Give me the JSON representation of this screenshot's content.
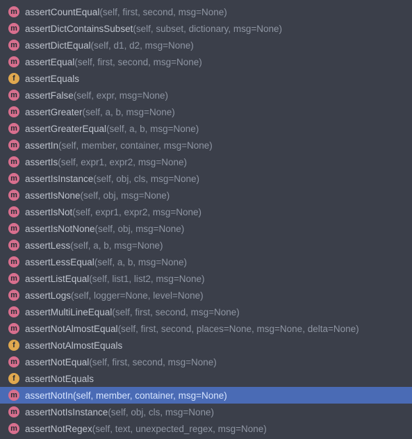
{
  "icon_glyph": {
    "m": "m",
    "f": "f"
  },
  "items": [
    {
      "kind": "m",
      "name": "assertCountEqual",
      "params": "(self, first, second, msg=None)",
      "selected": false
    },
    {
      "kind": "m",
      "name": "assertDictContainsSubset",
      "params": "(self, subset, dictionary, msg=None)",
      "selected": false
    },
    {
      "kind": "m",
      "name": "assertDictEqual",
      "params": "(self, d1, d2, msg=None)",
      "selected": false
    },
    {
      "kind": "m",
      "name": "assertEqual",
      "params": "(self, first, second, msg=None)",
      "selected": false
    },
    {
      "kind": "f",
      "name": "assertEquals",
      "params": "",
      "selected": false
    },
    {
      "kind": "m",
      "name": "assertFalse",
      "params": "(self, expr, msg=None)",
      "selected": false
    },
    {
      "kind": "m",
      "name": "assertGreater",
      "params": "(self, a, b, msg=None)",
      "selected": false
    },
    {
      "kind": "m",
      "name": "assertGreaterEqual",
      "params": "(self, a, b, msg=None)",
      "selected": false
    },
    {
      "kind": "m",
      "name": "assertIn",
      "params": "(self, member, container, msg=None)",
      "selected": false
    },
    {
      "kind": "m",
      "name": "assertIs",
      "params": "(self, expr1, expr2, msg=None)",
      "selected": false
    },
    {
      "kind": "m",
      "name": "assertIsInstance",
      "params": "(self, obj, cls, msg=None)",
      "selected": false
    },
    {
      "kind": "m",
      "name": "assertIsNone",
      "params": "(self, obj, msg=None)",
      "selected": false
    },
    {
      "kind": "m",
      "name": "assertIsNot",
      "params": "(self, expr1, expr2, msg=None)",
      "selected": false
    },
    {
      "kind": "m",
      "name": "assertIsNotNone",
      "params": "(self, obj, msg=None)",
      "selected": false
    },
    {
      "kind": "m",
      "name": "assertLess",
      "params": "(self, a, b, msg=None)",
      "selected": false
    },
    {
      "kind": "m",
      "name": "assertLessEqual",
      "params": "(self, a, b, msg=None)",
      "selected": false
    },
    {
      "kind": "m",
      "name": "assertListEqual",
      "params": "(self, list1, list2, msg=None)",
      "selected": false
    },
    {
      "kind": "m",
      "name": "assertLogs",
      "params": "(self, logger=None, level=None)",
      "selected": false
    },
    {
      "kind": "m",
      "name": "assertMultiLineEqual",
      "params": "(self, first, second, msg=None)",
      "selected": false
    },
    {
      "kind": "m",
      "name": "assertNotAlmostEqual",
      "params": "(self, first, second, places=None, msg=None, delta=None)",
      "selected": false
    },
    {
      "kind": "f",
      "name": "assertNotAlmostEquals",
      "params": "",
      "selected": false
    },
    {
      "kind": "m",
      "name": "assertNotEqual",
      "params": "(self, first, second, msg=None)",
      "selected": false
    },
    {
      "kind": "f",
      "name": "assertNotEquals",
      "params": "",
      "selected": false
    },
    {
      "kind": "m",
      "name": "assertNotIn",
      "params": "(self, member, container, msg=None)",
      "selected": true
    },
    {
      "kind": "m",
      "name": "assertNotIsInstance",
      "params": "(self, obj, cls, msg=None)",
      "selected": false
    },
    {
      "kind": "m",
      "name": "assertNotRegex",
      "params": "(self, text, unexpected_regex, msg=None)",
      "selected": false
    }
  ]
}
